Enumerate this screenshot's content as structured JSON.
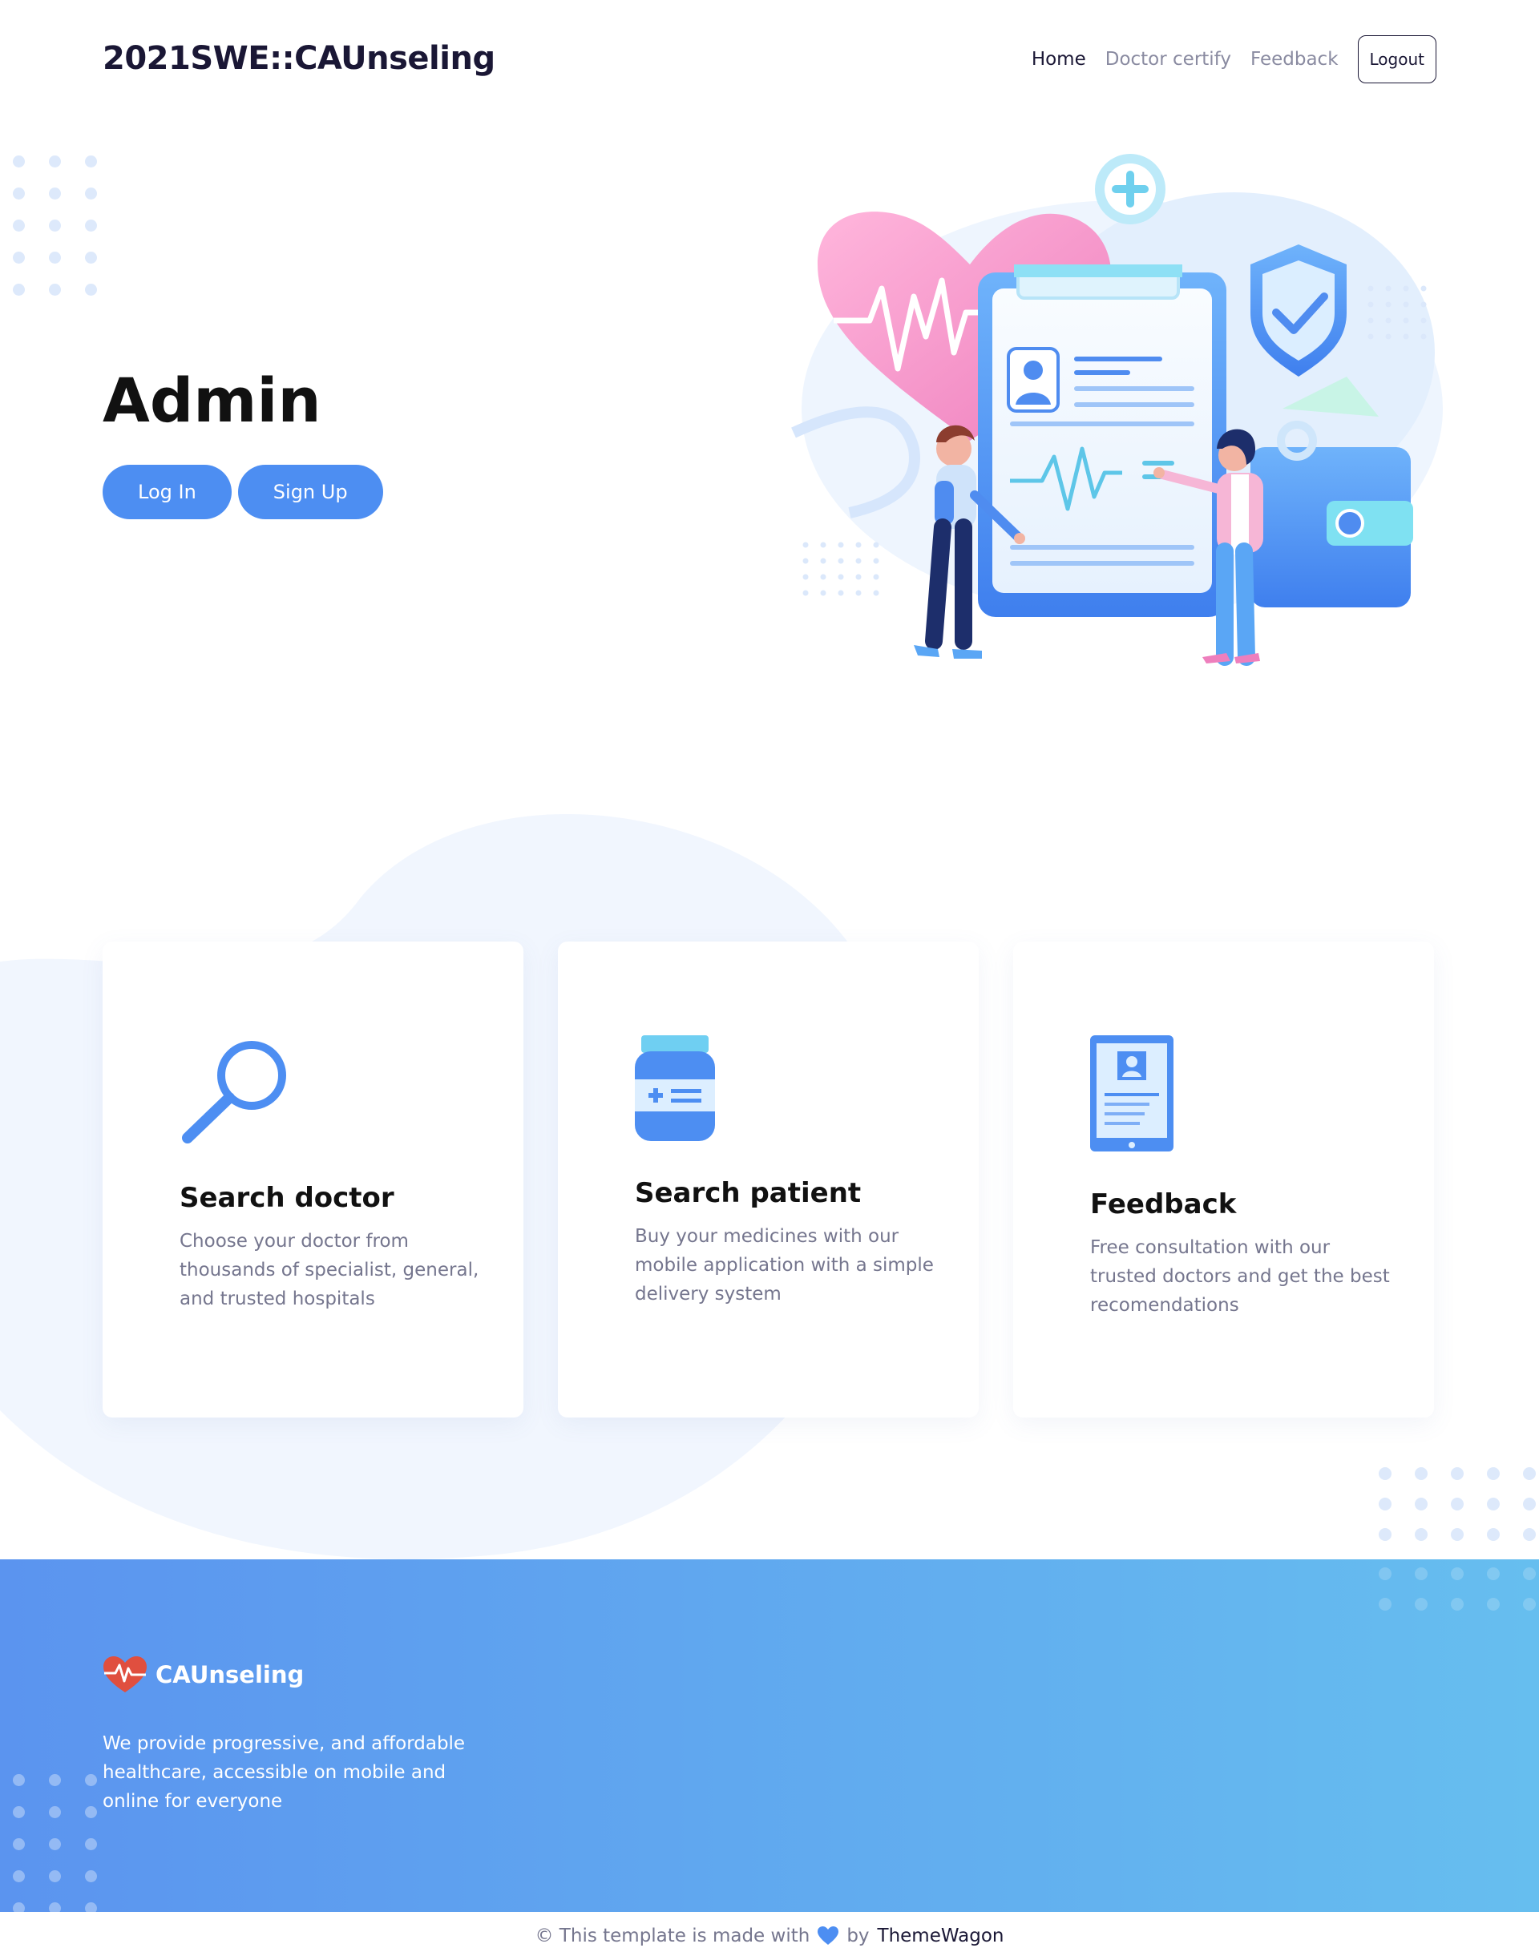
{
  "header": {
    "brand": "2021SWE::CAUnseling",
    "nav": [
      {
        "label": "Home",
        "active": true
      },
      {
        "label": "Doctor certify",
        "active": false
      },
      {
        "label": "Feedback",
        "active": false
      }
    ],
    "logout_label": "Logout"
  },
  "hero": {
    "title": "Admin",
    "login_label": "Log In",
    "signup_label": "Sign Up",
    "illustration_icon": "medical-clipboard-illustration"
  },
  "cards": [
    {
      "icon": "magnifier-icon",
      "title": "Search doctor",
      "description": "Choose your doctor from thousands of specialist, general, and trusted hospitals"
    },
    {
      "icon": "medicine-bottle-icon",
      "title": "Search patient",
      "description": "Buy your medicines with our mobile application with a simple delivery system"
    },
    {
      "icon": "tablet-profile-icon",
      "title": "Feedback",
      "description": "Free consultation with our trusted doctors and get the best recomendations"
    }
  ],
  "footer": {
    "brand": "CAUnseling",
    "description": "We provide progressive, and affordable healthcare, accessible on mobile and online for everyone",
    "credit_prefix": "© This template is made with",
    "credit_by": "by",
    "credit_author": "ThemeWagon"
  },
  "colors": {
    "accent": "#4d8ef2",
    "footer_start": "#5b94ef",
    "footer_end": "#66beef",
    "logo_heart": "#e04f3f"
  }
}
